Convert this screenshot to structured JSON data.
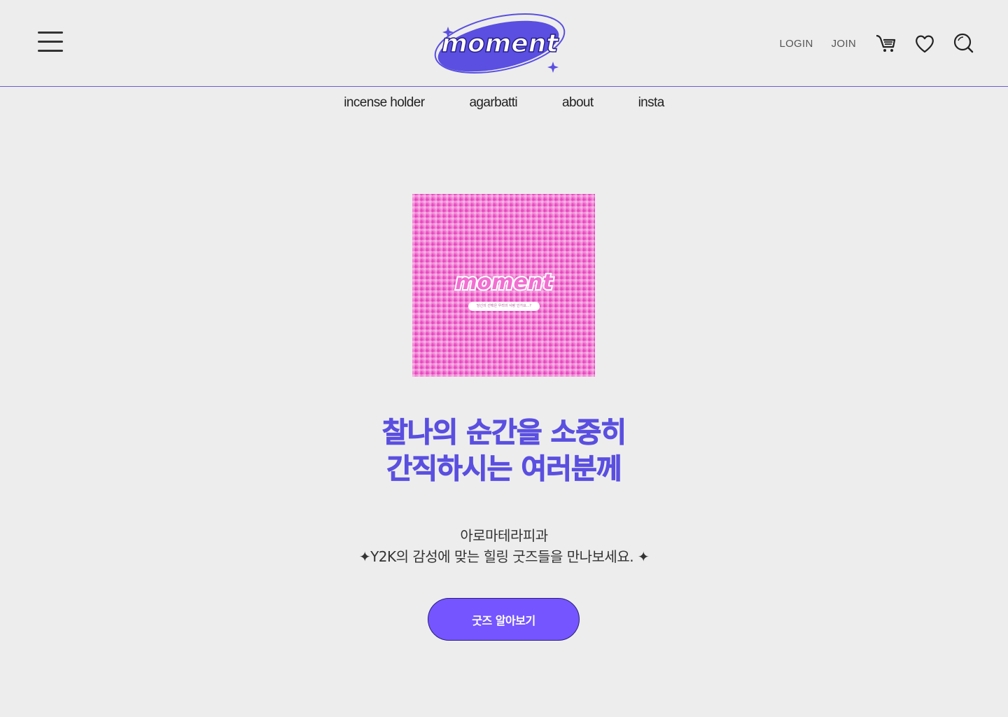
{
  "header": {
    "logo_text": "moment",
    "login_label": "LOGIN",
    "join_label": "JOIN",
    "icons": [
      "menu-icon",
      "cart-icon",
      "heart-icon",
      "search-icon"
    ]
  },
  "nav": {
    "items": [
      {
        "label": "incense holder"
      },
      {
        "label": "agarbatti"
      },
      {
        "label": "about"
      },
      {
        "label": "insta"
      }
    ]
  },
  "hero": {
    "image_logo_text": "moment",
    "image_caption": "당신의 선택은 우리의 사랑 인가요...?",
    "headline_line1": "찰나의 순간을 소중히",
    "headline_line2": "간직하시는 여러분께",
    "sub_line1": "아로마테라피과",
    "sub_line2": "✦Y2K의 감성에 맞는 힐링 굿즈들을 만나보세요. ✦",
    "cta_label": "굿즈 알아보기"
  },
  "colors": {
    "background": "#ededed",
    "accent": "#5a4fe0",
    "button": "#7555ff",
    "hero_pink": "#f26fd2"
  }
}
